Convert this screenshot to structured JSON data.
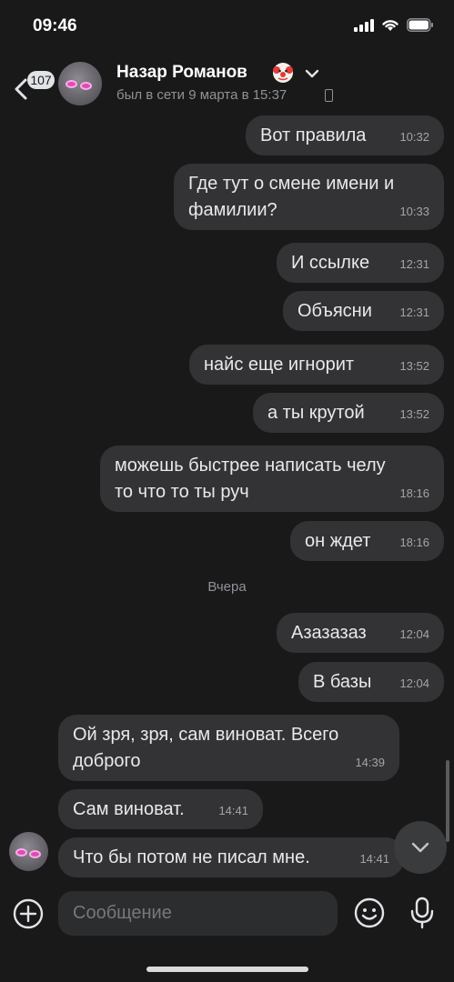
{
  "status_bar": {
    "time": "09:46"
  },
  "header": {
    "back_badge": "107",
    "name": "Назар Романов",
    "status": "был в сети 9 марта в 15:37",
    "name_icon": "clown-icon"
  },
  "messages": [
    {
      "text": "Вот правила",
      "time": "10:32",
      "side": "out"
    },
    {
      "text": "Где тут о смене имени и\nфамилии?",
      "time": "10:33",
      "side": "out"
    },
    {
      "text": "И ссылке",
      "time": "12:31",
      "side": "out"
    },
    {
      "text": "Объясни",
      "time": "12:31",
      "side": "out"
    },
    {
      "text": "найс еще игнорит",
      "time": "13:52",
      "side": "out"
    },
    {
      "text": "а ты крутой",
      "time": "13:52",
      "side": "out"
    },
    {
      "text": "можешь быстрее написать челу\nто что то ты руч",
      "time": "18:16",
      "side": "out"
    },
    {
      "text": "он ждет",
      "time": "18:16",
      "side": "out"
    },
    {
      "text": "Азазазаз",
      "time": "12:04",
      "side": "out"
    },
    {
      "text": "В базы",
      "time": "12:04",
      "side": "out"
    },
    {
      "text": "Ой зря, зря, сам виноват. Всего\nдоброго",
      "time": "14:39",
      "side": "in"
    },
    {
      "text": "Сам виноват.",
      "time": "14:41",
      "side": "in"
    },
    {
      "text": "Что бы потом не писал мне.",
      "time": "14:41",
      "side": "in"
    }
  ],
  "date_separator": "Вчера",
  "composer": {
    "placeholder": "Сообщение",
    "value": ""
  },
  "colors": {
    "background": "#19191a",
    "bubble": "#333335",
    "secondary_text": "#8f9297"
  }
}
